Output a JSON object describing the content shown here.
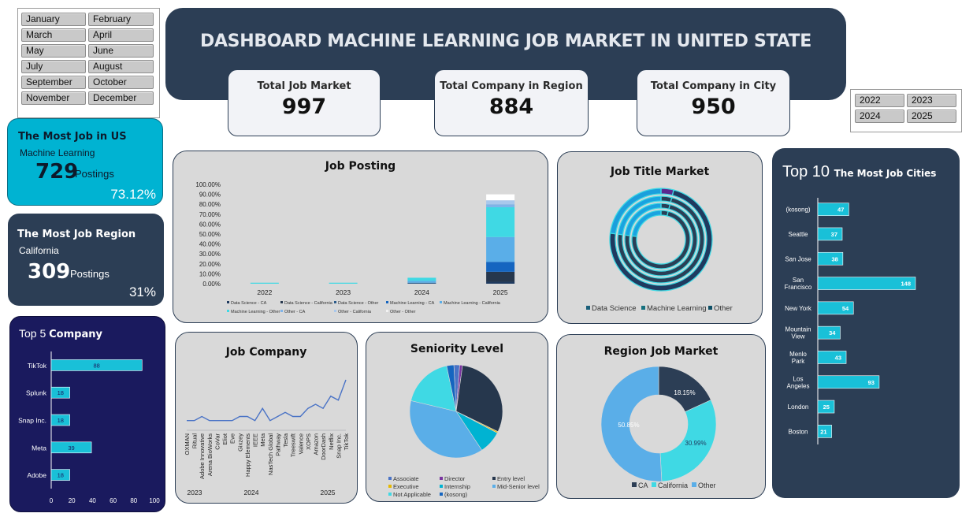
{
  "month_slicer": {
    "items": [
      "January",
      "February",
      "March",
      "April",
      "May",
      "June",
      "July",
      "August",
      "September",
      "October",
      "November",
      "December"
    ]
  },
  "year_slicer": {
    "items": [
      "2022",
      "2023",
      "2024",
      "2025"
    ]
  },
  "header": {
    "title": "DASHBOARD MACHINE LEARNING JOB MARKET IN UNITED STATE"
  },
  "kpis": {
    "total_job": {
      "label": "Total Job Market",
      "value": "997"
    },
    "company_region": {
      "label": "Total Company in Region",
      "value": "884"
    },
    "company_city": {
      "label": "Total Company in City",
      "value": "950"
    }
  },
  "most_job_us": {
    "title": "The Most Job in US",
    "subtitle": "Machine Learning",
    "value": "729",
    "unit": "Postings",
    "percent": "73.12%"
  },
  "most_job_region": {
    "title": "The Most Job Region",
    "subtitle": "California",
    "value": "309",
    "unit": "Postings",
    "percent": "31%"
  },
  "top5": {
    "title_a": "Top 5 ",
    "title_b": "Company"
  },
  "job_posting": {
    "title": "Job Posting"
  },
  "job_title_market": {
    "title": "Job Title Market"
  },
  "job_company": {
    "title": "Job Company"
  },
  "seniority": {
    "title": "Seniority Level"
  },
  "region_market": {
    "title": "Region Job Market"
  },
  "top10": {
    "title_a": "Top 10 ",
    "title_b": "The Most Job Cities"
  },
  "colors": {
    "navy": "#2c3e55",
    "cyan": "#00b3d2",
    "indigo": "#1a1a5e",
    "bar_cyan": "#19c0d8"
  },
  "chart_data": [
    {
      "id": "top5_company",
      "type": "bar",
      "orientation": "horizontal",
      "categories": [
        "TikTok",
        "Splunk",
        "Snap Inc.",
        "Meta",
        "Adobe"
      ],
      "values": [
        88,
        18,
        18,
        39,
        18
      ],
      "xlim": [
        0,
        100
      ],
      "xticks": [
        0,
        20,
        40,
        60,
        80,
        100
      ]
    },
    {
      "id": "job_posting",
      "type": "bar",
      "stacked": true,
      "categories": [
        "2022",
        "2023",
        "2024",
        "2025"
      ],
      "yticks": [
        "100.00%",
        "90.00%",
        "80.00%",
        "70.00%",
        "60.00%",
        "50.00%",
        "40.00%",
        "30.00%",
        "20.00%",
        "10.00%",
        "0.00%"
      ],
      "ylim": [
        0,
        100
      ],
      "series": [
        {
          "name": "Data Science - CA",
          "color": "#1f3a5f",
          "values": [
            0,
            0,
            0,
            2
          ]
        },
        {
          "name": "Data Science - California",
          "color": "#26374d",
          "values": [
            0,
            0,
            0,
            10
          ]
        },
        {
          "name": "Data Science - Other",
          "color": "#2c5b8a",
          "values": [
            0,
            0,
            1,
            0
          ]
        },
        {
          "name": "Machine Learning - CA",
          "color": "#1565c0",
          "values": [
            0,
            0,
            0,
            10
          ]
        },
        {
          "name": "Machine Learning - California",
          "color": "#5aaee8",
          "values": [
            0,
            0,
            2,
            25
          ]
        },
        {
          "name": "Machine Learning - Other",
          "color": "#3fd9e4",
          "values": [
            1,
            1,
            3,
            30
          ]
        },
        {
          "name": "Other - CA",
          "color": "#7fb3e8",
          "values": [
            0,
            0,
            0,
            3
          ]
        },
        {
          "name": "Other - California",
          "color": "#a9c8ec",
          "values": [
            0,
            0,
            0,
            4
          ]
        },
        {
          "name": "Other - Other",
          "color": "#ffffff",
          "values": [
            0,
            0,
            0,
            6
          ]
        }
      ]
    },
    {
      "id": "job_title_market",
      "type": "pie",
      "style": "multi-ring donut",
      "legend": [
        "Data Science",
        "Machine Learning",
        "Other"
      ],
      "legend_colors": [
        "#1a5f7a",
        "#15707e",
        "#0e4f66"
      ],
      "values": [
        4,
        73,
        23
      ]
    },
    {
      "id": "job_company",
      "type": "line",
      "x_groups": [
        "2023",
        "2024",
        "2025"
      ],
      "x_labels": [
        "OXMAN",
        "Ritual",
        "Adobe Innovative",
        "Arena BioWorks",
        "CoVar",
        "Eliot",
        "Eve",
        "Gixzey",
        "Happy Elements",
        "IEEE",
        "Meta",
        "NasTech Global",
        "Pathway",
        "Tesla",
        "Treeswift",
        "Valence",
        "XOPS",
        "Amazon",
        "DoorDash",
        "Netflix",
        "Snap Inc.",
        "TikTok"
      ],
      "values": [
        2,
        2,
        3,
        2,
        2,
        2,
        2,
        3,
        3,
        2,
        5,
        2,
        3,
        4,
        3,
        3,
        5,
        6,
        5,
        8,
        7,
        12
      ]
    },
    {
      "id": "seniority",
      "type": "pie",
      "legend": [
        "Associate",
        "Director",
        "Entry level",
        "Executive",
        "Internship",
        "Mid-Senior level",
        "Not Applicable",
        "(kosong)"
      ],
      "colors": [
        "#4a73c6",
        "#7a35a0",
        "#26374d",
        "#e6b800",
        "#00b3d2",
        "#5aaee8",
        "#3fd9e4",
        "#1565c0"
      ],
      "values": [
        2,
        1,
        30,
        0.5,
        8,
        38,
        18,
        2.5
      ]
    },
    {
      "id": "region_market",
      "type": "pie",
      "style": "donut",
      "legend": [
        "CA",
        "California",
        "Other"
      ],
      "colors": [
        "#2c3e55",
        "#3fd9e4",
        "#5aaee8"
      ],
      "values": [
        18.15,
        30.99,
        50.85
      ],
      "labels": [
        "18.15%",
        "30.99%",
        "50.85%"
      ]
    },
    {
      "id": "top10_cities",
      "type": "bar",
      "orientation": "horizontal",
      "categories": [
        "(kosong)",
        "Seattle",
        "San Jose",
        "San Francisco",
        "New York",
        "Mountain View",
        "Menlo Park",
        "Los Angeles",
        "London",
        "Boston"
      ],
      "values": [
        47,
        37,
        38,
        148,
        54,
        34,
        43,
        93,
        25,
        21
      ]
    }
  ]
}
